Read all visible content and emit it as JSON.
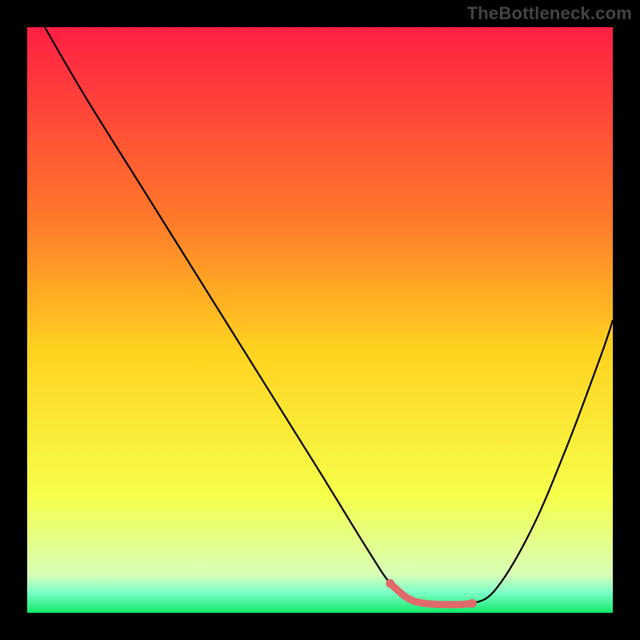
{
  "watermark": "TheBottleneck.com",
  "chart_data": {
    "type": "line",
    "title": "",
    "xlabel": "",
    "ylabel": "",
    "xlim": [
      0,
      100
    ],
    "ylim": [
      0,
      100
    ],
    "grid": false,
    "legend": false,
    "background_gradient_stops": [
      {
        "offset": 0.0,
        "color": "#ff1f44"
      },
      {
        "offset": 0.33,
        "color": "#ff7a2a"
      },
      {
        "offset": 0.55,
        "color": "#ffd21f"
      },
      {
        "offset": 0.8,
        "color": "#f6ff4a"
      },
      {
        "offset": 0.935,
        "color": "#d8ffb8"
      },
      {
        "offset": 0.965,
        "color": "#7dffc8"
      },
      {
        "offset": 1.0,
        "color": "#12e86a"
      }
    ],
    "series": [
      {
        "name": "bottleneck-curve",
        "color": "#000000",
        "width": 2.2,
        "x": [
          3,
          10,
          20,
          30,
          40,
          50,
          58,
          62,
          65,
          68,
          73,
          76,
          80,
          86,
          92,
          98,
          100
        ],
        "values": [
          100,
          88,
          72,
          56,
          40,
          24,
          11,
          5,
          2.5,
          1.6,
          1.4,
          1.6,
          4,
          14,
          28,
          44,
          50
        ]
      }
    ],
    "highlight": {
      "name": "flat-minimum",
      "color": "#e06a6a",
      "stroke_width": 9,
      "cap_radius": 5.5,
      "points_xy": [
        [
          62,
          5.0
        ],
        [
          65,
          2.5
        ],
        [
          68,
          1.6
        ],
        [
          73,
          1.4
        ],
        [
          76,
          1.6
        ]
      ]
    }
  }
}
